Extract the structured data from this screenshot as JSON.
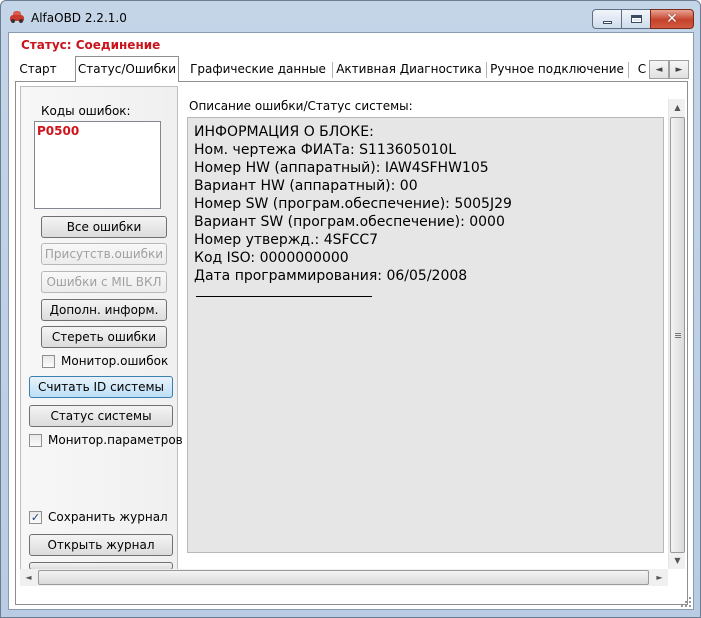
{
  "window": {
    "title": "AlfaOBD 2.2.1.0",
    "app_icon": "car-icon",
    "controls": {
      "minimize_icon": "minimize-icon",
      "maximize_icon": "maximize-icon",
      "close_icon": "close-icon",
      "close_glyph": "✕"
    }
  },
  "status": {
    "text": "Статус: Соединение",
    "color": "#c8141c"
  },
  "tabs": [
    {
      "label": "Старт"
    },
    {
      "label": "Статус/Ошибки",
      "active": true
    },
    {
      "label": "Графические данные"
    },
    {
      "label": "Активная Диагностика"
    },
    {
      "label": "Ручное подключение"
    },
    {
      "label": "С"
    }
  ],
  "tab_scroll": {
    "left": "◄",
    "right": "►"
  },
  "errors": {
    "label": "Коды ошибок:",
    "codes": [
      "P0500"
    ],
    "buttons": {
      "all": "Все ошибки",
      "present": "Присутств.ошибки",
      "mil_on": "Ошибки с MIL ВКЛ",
      "more_info": "Дополн. информ.",
      "clear": "Стереть ошибки"
    },
    "monitor_label": "Монитор.ошибок",
    "monitor_checked": false
  },
  "system": {
    "read_id_button": "Считать ID системы",
    "status_button": "Статус системы",
    "monitor_params_label": "Монитор.параметров",
    "monitor_params_checked": false
  },
  "log": {
    "save_label": "Сохранить журнал",
    "save_checked": true,
    "check_glyph": "✓",
    "open_button": "Открыть журнал"
  },
  "description": {
    "label": "Описание ошибки/Статус системы:",
    "lines": [
      "ИНФОРМАЦИЯ О БЛОКЕ:",
      "Ном. чертежа ФИАТа: S113605010L",
      "Номер HW (аппаратный): IAW4SFHW105",
      "Вариант HW (аппаратный): 00",
      "Номер SW (програм.обеспечение): 5005J29",
      "Вариант SW (програм.обеспечение): 0000",
      "Номер утвержд.: 4SFCC7",
      "Код ISO: 0000000000",
      "Дата программирования: 06/05/2008"
    ]
  },
  "scrollbars": {
    "up": "▲",
    "down": "▼",
    "left": "◄",
    "right": "►"
  },
  "colors": {
    "error_code": "#d0141c",
    "accent_button": "#bddff6",
    "title_bar": "#c5d5e8"
  }
}
